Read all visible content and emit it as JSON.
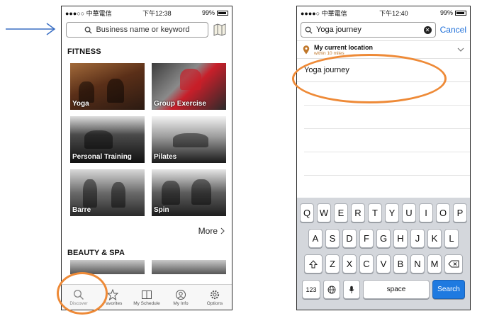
{
  "left_phone": {
    "status": {
      "carrier": "●●●○○ 中華電信",
      "time": "下午12:38",
      "battery": "99%"
    },
    "search": {
      "placeholder": "Business name or keyword"
    },
    "fitness": {
      "title": "FITNESS",
      "tiles": [
        "Yoga",
        "Group Exercise",
        "Personal Training",
        "Pilates",
        "Barre",
        "Spin"
      ],
      "more": "More"
    },
    "beauty": {
      "title": "BEAUTY & SPA"
    },
    "tabs": [
      "Discover",
      "Favorites",
      "My Schedule",
      "My Info",
      "Options"
    ]
  },
  "right_phone": {
    "status": {
      "carrier": "●●●●○ 中華電信",
      "time": "下午12:40",
      "battery": "99%"
    },
    "search": {
      "query": "Yoga journey",
      "cancel": "Cancel"
    },
    "location": {
      "title": "My current location",
      "subtitle": "within 10 miles"
    },
    "suggestion": "Yoga journey",
    "keyboard": {
      "row1": [
        "Q",
        "W",
        "E",
        "R",
        "T",
        "Y",
        "U",
        "I",
        "O",
        "P"
      ],
      "row2": [
        "A",
        "S",
        "D",
        "F",
        "G",
        "H",
        "J",
        "K",
        "L"
      ],
      "row3": [
        "Z",
        "X",
        "C",
        "V",
        "B",
        "N",
        "M"
      ],
      "num": "123",
      "space": "space",
      "search": "Search"
    }
  },
  "colors": {
    "highlight": "#ee8a37",
    "link_blue": "#1e6fd9",
    "arrow_blue": "#3a6fc4"
  },
  "icons": [
    "arrow-right-icon",
    "search-icon",
    "map-icon",
    "chevron-right-icon",
    "star-icon",
    "book-icon",
    "person-icon",
    "gear-icon",
    "location-pin-icon",
    "chevron-down-icon",
    "clear-icon",
    "shift-icon",
    "backspace-icon",
    "globe-icon",
    "mic-icon"
  ]
}
